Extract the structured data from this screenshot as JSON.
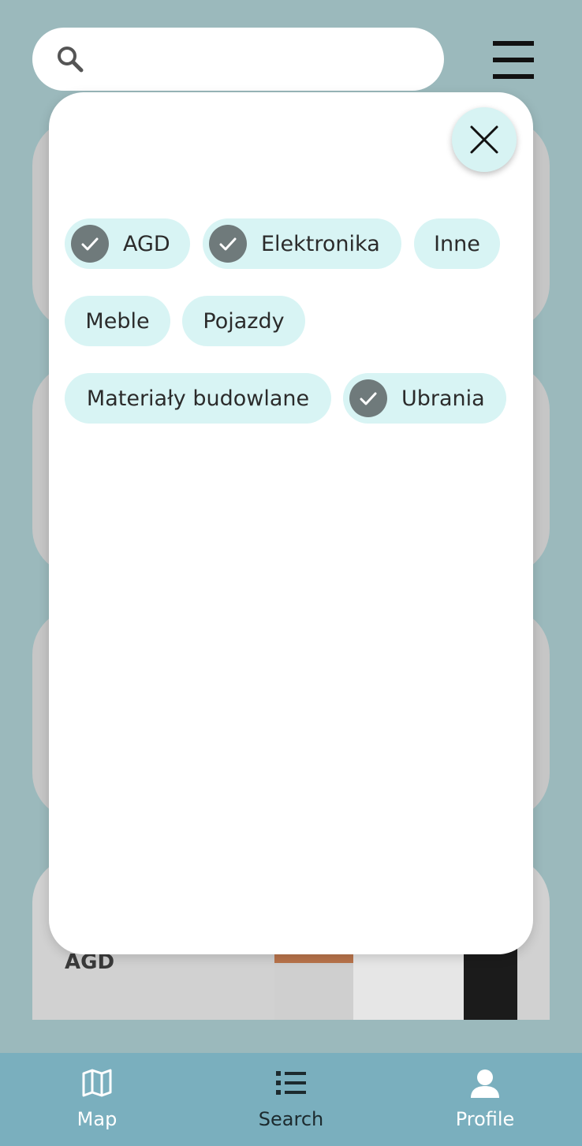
{
  "search": {
    "placeholder": "",
    "value": ""
  },
  "background_card": {
    "title": "AGD"
  },
  "filter_chips": [
    {
      "label": "AGD",
      "checked": true
    },
    {
      "label": "Elektronika",
      "checked": true
    },
    {
      "label": "Inne",
      "checked": false
    },
    {
      "label": "Meble",
      "checked": false
    },
    {
      "label": "Pojazdy",
      "checked": false
    },
    {
      "label": "Materiały budowlane",
      "checked": false
    },
    {
      "label": "Ubrania",
      "checked": true
    }
  ],
  "bottom_nav": {
    "items": [
      {
        "label": "Map",
        "icon": "map-icon",
        "active": false
      },
      {
        "label": "Search",
        "icon": "list-icon",
        "active": true
      },
      {
        "label": "Profile",
        "icon": "person-icon",
        "active": false
      }
    ]
  },
  "colors": {
    "background": "#9bb9bc",
    "chip_background": "#d8f4f4",
    "check_circle": "#6f7a7b",
    "nav_background": "#7aafbe",
    "nav_active_text": "#1c2a2e",
    "nav_inactive_text": "#ffffff"
  }
}
